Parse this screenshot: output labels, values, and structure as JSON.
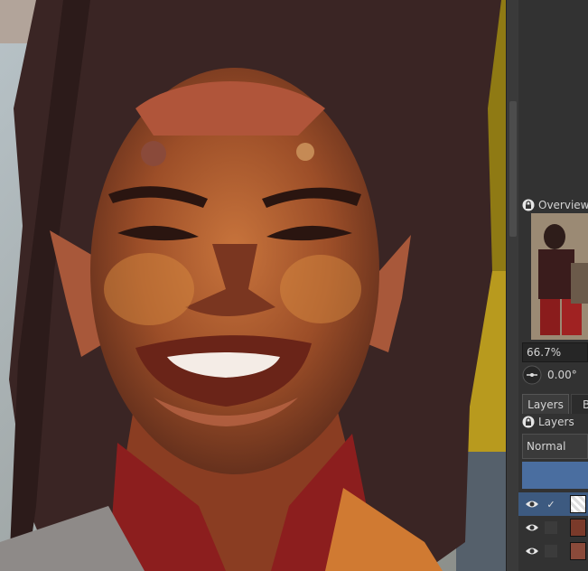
{
  "app": {
    "accent": "#4a6ea0"
  },
  "overview": {
    "title": "Overview"
  },
  "zoom": {
    "value": "66.7%"
  },
  "rotation": {
    "value": "0.00°"
  },
  "dock_tabs": [
    {
      "label": "Layers"
    },
    {
      "label": "B"
    }
  ],
  "layers_panel": {
    "title": "Layers",
    "blend_mode": "Normal",
    "layers": [
      {
        "visible": true,
        "checked": true,
        "selected": true
      },
      {
        "visible": true,
        "checked": false,
        "selected": false
      },
      {
        "visible": true,
        "checked": false,
        "selected": false
      },
      {
        "visible": true,
        "checked": false,
        "selected": false
      }
    ]
  },
  "icons": [
    "lock-icon",
    "eye-icon",
    "rotate-icon",
    "checkmark-icon"
  ]
}
